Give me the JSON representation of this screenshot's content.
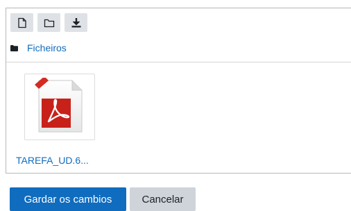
{
  "filemanager": {
    "toolbar": {
      "buttons": [
        {
          "icon": "new-file-icon"
        },
        {
          "icon": "folder-icon"
        },
        {
          "icon": "download-icon"
        }
      ]
    },
    "path": {
      "crumb_label": "Ficheiros"
    },
    "files": [
      {
        "name": "TAREFA_UD.6...",
        "icon": "pdf-file-icon"
      }
    ]
  },
  "actions": {
    "save_label": "Gardar os cambios",
    "cancel_label": "Cancelar"
  },
  "colors": {
    "link": "#0f6cbf",
    "primary_button": "#0f6cbf",
    "secondary_button": "#ced4da",
    "toolbar_button": "#dee2e6",
    "pdf_red": "#c8211a"
  }
}
